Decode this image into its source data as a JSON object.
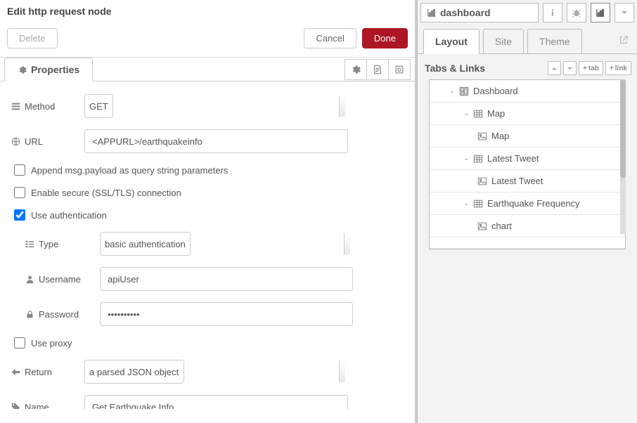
{
  "header": {
    "title": "Edit http request node",
    "delete_label": "Delete",
    "cancel_label": "Cancel",
    "done_label": "Done"
  },
  "tabs": {
    "properties_label": "Properties"
  },
  "form": {
    "method_label": "Method",
    "method_value": "GET",
    "url_label": "URL",
    "url_value": "<APPURL>/earthquakeinfo",
    "append_label": "Append msg.payload as query string parameters",
    "append_checked": false,
    "ssl_label": "Enable secure (SSL/TLS) connection",
    "ssl_checked": false,
    "auth_label": "Use authentication",
    "auth_checked": true,
    "auth_type_label": "Type",
    "auth_type_value": "basic authentication",
    "username_label": "Username",
    "username_value": "apiUser",
    "password_label": "Password",
    "password_value": "••••••••••",
    "proxy_label": "Use proxy",
    "proxy_checked": false,
    "return_label": "Return",
    "return_value": "a parsed JSON object",
    "name_label": "Name",
    "name_value": "Get Earthquake Info"
  },
  "sidebar": {
    "dashboard_title": "dashboard",
    "tabs": {
      "layout": "Layout",
      "site": "Site",
      "theme": "Theme"
    },
    "section_title": "Tabs & Links",
    "add_tab": "tab",
    "add_link": "link",
    "tree": {
      "dashboard": "Dashboard",
      "map_group": "Map",
      "map_widget": "Map",
      "tweet_group": "Latest Tweet",
      "tweet_widget": "Latest Tweet",
      "eq_group": "Earthquake Frequency",
      "chart_widget": "chart"
    }
  }
}
